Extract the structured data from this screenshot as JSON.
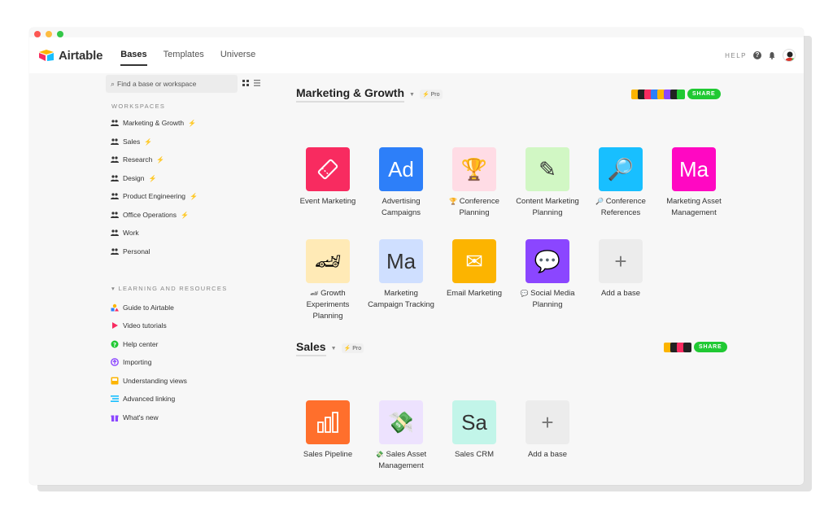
{
  "window": {
    "traffic_colors": [
      "#fc5753",
      "#fdbc40",
      "#33c748"
    ]
  },
  "topbar": {
    "logo_text": "Airtable",
    "tabs": [
      {
        "label": "Bases",
        "active": true
      },
      {
        "label": "Templates",
        "active": false
      },
      {
        "label": "Universe",
        "active": false
      }
    ],
    "help_label": "HELP",
    "help_icon": "?"
  },
  "sidebar": {
    "search_placeholder": "Find a base or workspace",
    "workspaces_label": "WORKSPACES",
    "workspaces": [
      {
        "label": "Marketing & Growth",
        "pro": true
      },
      {
        "label": "Sales",
        "pro": true
      },
      {
        "label": "Research",
        "pro": true
      },
      {
        "label": "Design",
        "pro": true
      },
      {
        "label": "Product Engineering",
        "pro": true
      },
      {
        "label": "Office Operations",
        "pro": true
      },
      {
        "label": "Work",
        "pro": false
      },
      {
        "label": "Personal",
        "pro": false
      }
    ],
    "learning_label": "LEARNING AND RESOURCES",
    "learning": [
      {
        "label": "Guide to Airtable",
        "icon": "shapes-icon",
        "color": "#2d7ff9"
      },
      {
        "label": "Video tutorials",
        "icon": "play-icon",
        "color": "#f82b60"
      },
      {
        "label": "Help center",
        "icon": "question-icon",
        "color": "#20c933"
      },
      {
        "label": "Importing",
        "icon": "upload-icon",
        "color": "#8b46ff"
      },
      {
        "label": "Understanding views",
        "icon": "views-icon",
        "color": "#fcb400"
      },
      {
        "label": "Advanced linking",
        "icon": "linking-icon",
        "color": "#18bfff"
      },
      {
        "label": "What's new",
        "icon": "gift-icon",
        "color": "#8b46ff"
      }
    ]
  },
  "groups": [
    {
      "title": "Marketing & Growth",
      "pro_label": "Pro",
      "share_label": "SHARE",
      "bases": [
        {
          "label": "Event Marketing",
          "emoji": "",
          "tile_text": "",
          "icon": "ticket-icon",
          "bg": "#f82b60",
          "fg": "#ffffff"
        },
        {
          "label": "Advertising Campaigns",
          "emoji": "",
          "tile_text": "Ad",
          "icon": "text-icon",
          "bg": "#2d7ff9",
          "fg": "#ffffff"
        },
        {
          "label": "Conference Planning",
          "emoji": "🏆",
          "tile_text": "🏆",
          "icon": "trophy-icon",
          "bg": "#ffdce5",
          "fg": "#d4a017"
        },
        {
          "label": "Content Marketing Planning",
          "emoji": "",
          "tile_text": "✎",
          "icon": "pencil-icon",
          "bg": "#d1f7c4",
          "fg": "#333333"
        },
        {
          "label": "Conference References",
          "emoji": "🔎",
          "tile_text": "🔎",
          "icon": "magnifier-icon",
          "bg": "#18bfff",
          "fg": "#333333"
        },
        {
          "label": "Marketing Asset Management",
          "emoji": "",
          "tile_text": "Ma",
          "icon": "text-icon",
          "bg": "#ff08c2",
          "fg": "#ffffff"
        },
        {
          "label": "Growth Experiments Planning",
          "emoji": "🏎",
          "tile_text": "🏎",
          "icon": "racecar-icon",
          "bg": "#ffeab6",
          "fg": "#cc0000"
        },
        {
          "label": "Marketing Campaign Tracking",
          "emoji": "",
          "tile_text": "Ma",
          "icon": "text-icon",
          "bg": "#cfdfff",
          "fg": "#333333"
        },
        {
          "label": "Email Marketing",
          "emoji": "",
          "tile_text": "✉",
          "icon": "envelope-icon",
          "bg": "#fcb400",
          "fg": "#ffffff"
        },
        {
          "label": "Social Media Planning",
          "emoji": "💬",
          "tile_text": "💬",
          "icon": "speech-bubble-icon",
          "bg": "#8b46ff",
          "fg": "#ffffff"
        },
        {
          "label": "Add a base",
          "emoji": "",
          "tile_text": "+",
          "icon": "plus-icon",
          "bg": "#ececec",
          "fg": "#777777"
        }
      ]
    },
    {
      "title": "Sales",
      "pro_label": "Pro",
      "share_label": "SHARE",
      "bases": [
        {
          "label": "Sales Pipeline",
          "emoji": "",
          "tile_text": "",
          "icon": "bar-chart-icon",
          "bg": "#ff6f2c",
          "fg": "#ffffff"
        },
        {
          "label": "Sales Asset Management",
          "emoji": "💸",
          "tile_text": "💸",
          "icon": "money-icon",
          "bg": "#ede2fe",
          "fg": "#333333"
        },
        {
          "label": "Sales CRM",
          "emoji": "",
          "tile_text": "Sa",
          "icon": "text-icon",
          "bg": "#c2f5e9",
          "fg": "#333333"
        },
        {
          "label": "Add a base",
          "emoji": "",
          "tile_text": "+",
          "icon": "plus-icon",
          "bg": "#ececec",
          "fg": "#777777"
        }
      ]
    }
  ]
}
